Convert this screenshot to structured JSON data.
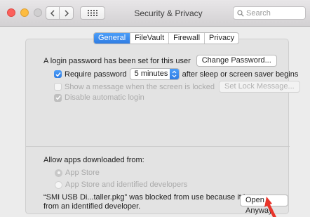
{
  "window": {
    "title": "Security & Privacy",
    "search_placeholder": "Search"
  },
  "tabs": [
    {
      "label": "General",
      "active": true
    },
    {
      "label": "FileVault",
      "active": false
    },
    {
      "label": "Firewall",
      "active": false
    },
    {
      "label": "Privacy",
      "active": false
    }
  ],
  "general": {
    "login_password_text": "A login password has been set for this user",
    "change_password_button": "Change Password...",
    "require_password_label": "Require password",
    "require_password_checked": true,
    "require_password_delay": "5 minutes",
    "after_sleep_text": "after sleep or screen saver begins",
    "show_message_label": "Show a message when the screen is locked",
    "show_message_checked": false,
    "set_lock_message_button": "Set Lock Message...",
    "disable_auto_login_label": "Disable automatic login",
    "disable_auto_login_checked": true
  },
  "downloads": {
    "heading": "Allow apps downloaded from:",
    "options": [
      {
        "label": "App Store",
        "selected": true
      },
      {
        "label": "App Store and identified developers",
        "selected": false
      }
    ],
    "blocked_line1": "“SMI USB Di...taller.pkg” was blocked from use because it is not",
    "blocked_line2": "from an identified developer.",
    "open_anyway_button": "Open Anyway"
  },
  "colors": {
    "accent": "#2f7de3",
    "annotation_arrow": "#e8352a"
  }
}
